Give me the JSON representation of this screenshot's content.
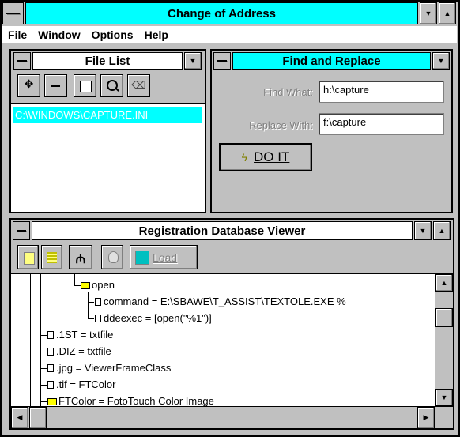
{
  "app": {
    "title": "Change of Address",
    "menu": [
      "File",
      "Window",
      "Options",
      "Help"
    ]
  },
  "file_list": {
    "title": "File List",
    "toolbar_icons": [
      "add-icon",
      "remove-icon",
      "new-icon",
      "search-icon",
      "clear-icon"
    ],
    "items": [
      "C:\\WINDOWS\\CAPTURE.INI"
    ]
  },
  "find_replace": {
    "title": "Find and Replace",
    "find_label": "Find What:",
    "find_value": "h:\\capture",
    "replace_label": "Replace With:",
    "replace_value": "f:\\capture",
    "do_it_label": "DO IT"
  },
  "reg_viewer": {
    "title": "Registration Database Viewer",
    "load_label": "Load",
    "tree": [
      {
        "type": "folder",
        "text": "open"
      },
      {
        "type": "doc",
        "text": "command = E:\\SBAWE\\T_ASSIST\\TEXTOLE.EXE %"
      },
      {
        "type": "doc",
        "text": "ddeexec = [open(\"%1\")]"
      },
      {
        "type": "doc",
        "text": ".1ST = txtfile"
      },
      {
        "type": "doc",
        "text": ".DIZ = txtfile"
      },
      {
        "type": "doc",
        "text": ".jpg = ViewerFrameClass"
      },
      {
        "type": "doc",
        "text": ".tif = FTColor"
      },
      {
        "type": "folder",
        "text": "FTColor = FotoTouch Color Image"
      }
    ]
  }
}
